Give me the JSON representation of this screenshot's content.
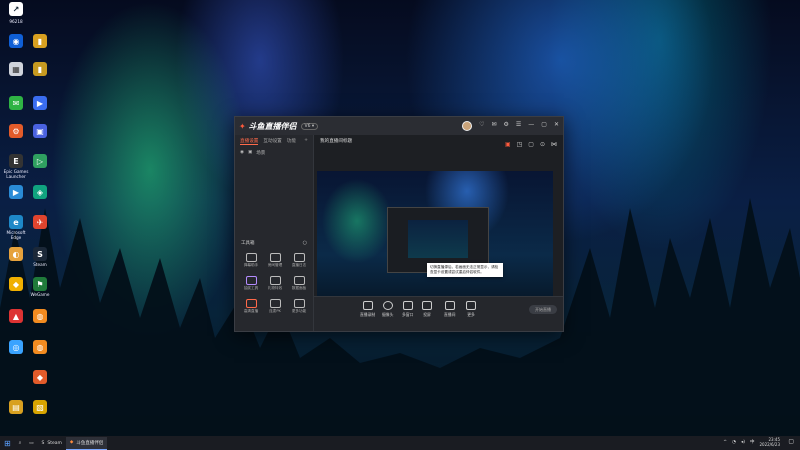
{
  "colors": {
    "accent": "#ff5a3c",
    "taskbar": "#1a1c22"
  },
  "desktop": {
    "icons": [
      {
        "label": "",
        "color": "#ffffff",
        "glyph": "↗"
      },
      {
        "label": "96218",
        "color": "#1f2a44",
        "glyph": "▣"
      },
      {
        "label": "",
        "color": "#0f5fd6",
        "glyph": "◉"
      },
      {
        "label": "",
        "color": "#d0d4dc",
        "glyph": "▦"
      },
      {
        "label": "",
        "color": "#2fb344",
        "glyph": "✉"
      },
      {
        "label": "",
        "color": "#e25b2a",
        "glyph": "⚙"
      },
      {
        "label": "Epic Games Launcher",
        "color": "#333333",
        "glyph": "E"
      },
      {
        "label": "",
        "color": "#2a8bd6",
        "glyph": "▶"
      },
      {
        "label": "Microsoft Edge",
        "color": "#1e88c7",
        "glyph": "e"
      },
      {
        "label": "",
        "color": "#e6a23c",
        "glyph": "◐"
      },
      {
        "label": "",
        "color": "#f0b000",
        "glyph": "◆"
      },
      {
        "label": "",
        "color": "#d33",
        "glyph": "▲"
      },
      {
        "label": "",
        "color": "#3aa3ff",
        "glyph": "◎"
      },
      {
        "label": "",
        "color": "#d8a020",
        "glyph": "▤"
      }
    ],
    "icons2": [
      {
        "label": "WeGame",
        "color": "#1f7a3a",
        "glyph": "⚑"
      },
      {
        "label": "Steam",
        "color": "#1b2838",
        "glyph": "S"
      },
      {
        "label": "",
        "color": "#3a6df0",
        "glyph": "▶"
      },
      {
        "label": "",
        "color": "#10a37f",
        "glyph": "◈"
      },
      {
        "label": "",
        "color": "#e0442e",
        "glyph": "✈"
      },
      {
        "label": "",
        "color": "#f28b20",
        "glyph": "◍"
      },
      {
        "label": "",
        "color": "#d7a400",
        "glyph": "▧"
      }
    ]
  },
  "window": {
    "app_name": "斗鱼直播伴侣",
    "version": "V6 ▾",
    "tabs": [
      "直播设置",
      "互动设置",
      "功能"
    ],
    "scene_label": "场景",
    "tools_title": "工具箱",
    "tools": [
      {
        "label": "弹幕助手"
      },
      {
        "label": "房间管理"
      },
      {
        "label": "直播日志"
      },
      {
        "label": "抽奖工具"
      },
      {
        "label": "礼物特效"
      },
      {
        "label": "数据面板"
      },
      {
        "label": "高清直播"
      },
      {
        "label": "连麦PK"
      },
      {
        "label": "更多功能"
      }
    ],
    "stream_title": "我的直播间标题",
    "bottom_actions": [
      {
        "label": "直播录制"
      },
      {
        "label": "摄像头"
      },
      {
        "label": "多窗口"
      },
      {
        "label": "投屏"
      },
      {
        "label": "直播间"
      },
      {
        "label": "更多"
      }
    ],
    "live_button": "开始直播"
  },
  "tooltip": {
    "text": "切换直播源后，若画面无法正常显示，请检查显卡设置或尝试重启伴侣软件。"
  },
  "taskbar": {
    "items": [
      {
        "label": "Steam"
      },
      {
        "label": "斗鱼直播伴侣"
      }
    ],
    "time": "23:45",
    "date": "2022/6/23"
  }
}
